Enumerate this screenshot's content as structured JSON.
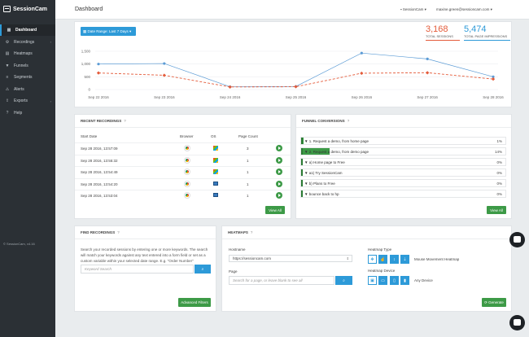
{
  "app": {
    "logo_text": "SessionCam",
    "version_footer": "© SessionCam, v4.16"
  },
  "sidebar": {
    "items": [
      {
        "label": "Dashboard",
        "icon": "dashboard-icon",
        "active": true,
        "has_chevron": false
      },
      {
        "label": "Recordings",
        "icon": "gear-icon",
        "active": false,
        "has_chevron": true
      },
      {
        "label": "Heatmaps",
        "icon": "heatmap-icon",
        "active": false,
        "has_chevron": false
      },
      {
        "label": "Funnels",
        "icon": "funnel-icon",
        "active": false,
        "has_chevron": false
      },
      {
        "label": "Segments",
        "icon": "segments-icon",
        "active": false,
        "has_chevron": false
      },
      {
        "label": "Alerts",
        "icon": "alert-icon",
        "active": false,
        "has_chevron": false
      },
      {
        "label": "Exports",
        "icon": "export-icon",
        "active": false,
        "has_chevron": true
      },
      {
        "label": "Help",
        "icon": "help-icon",
        "active": false,
        "has_chevron": false
      }
    ]
  },
  "header": {
    "title": "Dashboard",
    "account": "SessionCam",
    "user": "maxine.green@sessioncam.com"
  },
  "dashboard": {
    "date_range_label": "Date Range: Last 7 Days",
    "stats": [
      {
        "value": "3,168",
        "label": "TOTAL SESSIONS"
      },
      {
        "value": "5,474",
        "label": "TOTAL PAGE IMPRESSIONS"
      }
    ]
  },
  "chart_data": {
    "type": "line",
    "x": [
      "Sep 22 2016",
      "Sep 23 2016",
      "Sep 24 2016",
      "Sep 25 2016",
      "Sep 26 2016",
      "Sep 27 2016",
      "Sep 28 2016"
    ],
    "y_ticks": [
      "1,500",
      "1,000",
      "500",
      "0"
    ],
    "ylim": [
      0,
      1500
    ],
    "series": [
      {
        "values": [
          1000,
          1020,
          110,
          120,
          1430,
          1200,
          500
        ],
        "color": "#5b9bd5",
        "style": "solid"
      },
      {
        "values": [
          650,
          560,
          100,
          110,
          640,
          660,
          410
        ],
        "color": "#e45b3a",
        "style": "dashed"
      }
    ]
  },
  "recent_recordings": {
    "title": "RECENT RECORDINGS",
    "headers": [
      "Start Date",
      "Browser",
      "OS",
      "Page Count"
    ],
    "rows": [
      {
        "date": "Sep 28 2016, 13:57:09",
        "browser": "chrome-icon",
        "os": "windows-icon",
        "count": "3"
      },
      {
        "date": "Sep 28 2016, 13:55:32",
        "browser": "chrome-icon",
        "os": "windows-icon",
        "count": "1"
      },
      {
        "date": "Sep 28 2016, 13:54:49",
        "browser": "chrome-icon",
        "os": "windows-icon",
        "count": "1"
      },
      {
        "date": "Sep 28 2016, 13:54:20",
        "browser": "chrome-icon",
        "os": "monitor-icon",
        "count": "1"
      },
      {
        "date": "Sep 28 2016, 13:53:04",
        "browser": "chrome-icon",
        "os": "monitor-icon",
        "count": "1"
      }
    ],
    "view_all_label": "View All"
  },
  "funnel_conversions": {
    "title": "FUNNEL CONVERSIONS",
    "rows": [
      {
        "label": "1. Request a demo, from home page",
        "pct": "1%",
        "fill": 0.01
      },
      {
        "label": "2. Request a demo, from demo page",
        "pct": "14%",
        "fill": 0.14
      },
      {
        "label": "a) Home page to Free",
        "pct": "0%",
        "fill": 0
      },
      {
        "label": "a1) Try SessionCam",
        "pct": "0%",
        "fill": 0
      },
      {
        "label": "b) Plans to Free",
        "pct": "0%",
        "fill": 0
      },
      {
        "label": "bounce back to hp",
        "pct": "0%",
        "fill": 0
      }
    ],
    "view_all_label": "View All"
  },
  "find_recordings": {
    "title": "FIND RECORDINGS",
    "description": "Search your recorded sessions by entering one or more keywords. The search will match your keywords against any text entered into a form field or set as a custom variable within your selected date range. E.g. \"Order Number\"",
    "placeholder": "Keyword Search",
    "advanced_label": "Advanced Filters"
  },
  "heatmaps": {
    "title": "HEATMAPS",
    "hostname_label": "Hostname",
    "hostname_value": "https://sessioncam.com",
    "page_label": "Page",
    "page_placeholder": "Search for a page, or leave blank to see all",
    "type_label": "Heatmap Type",
    "type_selected": "Mouse Movement Heatmap",
    "device_label": "Heatmap Device",
    "device_selected": "Any Device",
    "generate_label": "Generate"
  }
}
